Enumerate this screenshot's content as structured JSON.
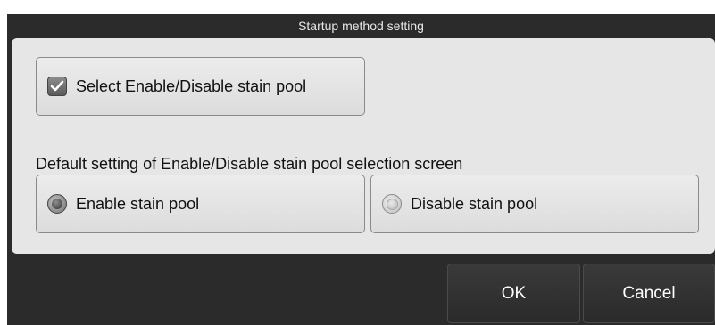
{
  "dialog": {
    "title": "Startup method setting"
  },
  "select_option": {
    "label": "Select Enable/Disable stain pool",
    "checked": true
  },
  "default_section": {
    "label": "Default setting of Enable/Disable stain pool selection screen",
    "options": [
      {
        "label": "Enable stain pool",
        "selected": true
      },
      {
        "label": "Disable stain pool",
        "selected": false
      }
    ]
  },
  "buttons": {
    "ok": "OK",
    "cancel": "Cancel"
  },
  "icons": {
    "check": "check-icon",
    "radio_on": "radio-selected-icon",
    "radio_off": "radio-unselected-icon"
  }
}
